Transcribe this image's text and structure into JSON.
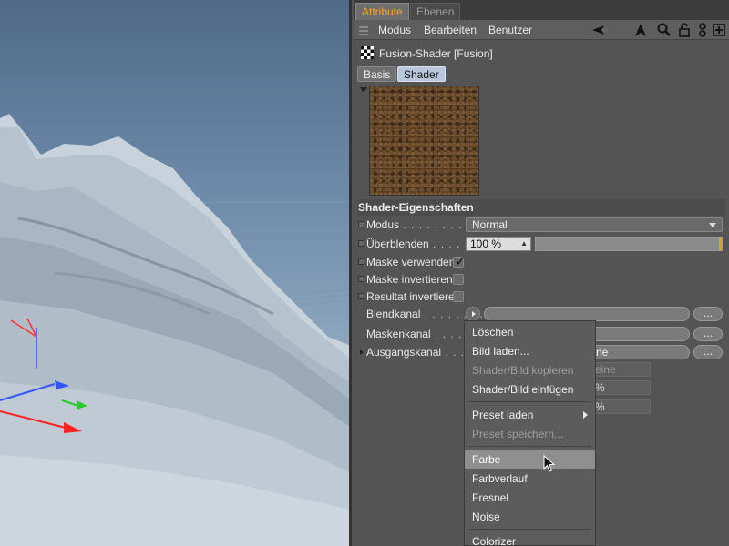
{
  "tabs": {
    "attribute": "Attribute",
    "ebenen": "Ebenen"
  },
  "menu": {
    "modus": "Modus",
    "bearbeiten": "Bearbeiten",
    "benutzer": "Benutzer"
  },
  "object": {
    "title": "Fusion-Shader [Fusion]"
  },
  "subtabs": {
    "basis": "Basis",
    "shader": "Shader"
  },
  "section": {
    "title": "Shader-Eigenschaften"
  },
  "rows": {
    "modus": {
      "label": "Modus",
      "dots": " . . . . . . . . . . . .",
      "value": "Normal"
    },
    "ueberblenden": {
      "label": "Überblenden",
      "dots": " . . . . . .",
      "value": "100 %",
      "level": 1.0
    },
    "maske_verwenden": {
      "label": "Maske verwenden",
      "checked": true
    },
    "maske_invertieren": {
      "label": "Maske invertieren"
    },
    "resultat_invertieren": {
      "label": "Resultat invertieren"
    },
    "blendkanal": {
      "label": "Blendkanal",
      "dots": " . . . . . . . . ."
    },
    "maskenkanal": {
      "label": "Maskenkanal",
      "dots": " . . . . . . . ."
    },
    "ausgangskanal": {
      "label": "Ausgangskanal",
      "dots": " . . . . .",
      "value": "ne"
    },
    "extra1": {
      "value": "eine"
    },
    "extra2": {
      "value": "%"
    },
    "extra3": {
      "value": "%"
    }
  },
  "buttons": {
    "dots": "..."
  },
  "context_menu": {
    "items": [
      {
        "label": "Löschen",
        "enabled": true
      },
      {
        "label": "Bild laden...",
        "enabled": true
      },
      {
        "label": "Shader/Bild kopieren",
        "enabled": false
      },
      {
        "label": "Shader/Bild einfügen",
        "enabled": true
      },
      {
        "label": "Preset laden",
        "enabled": true,
        "submenu": true
      },
      {
        "label": "Preset speichern...",
        "enabled": false
      },
      {
        "label": "Farbe",
        "enabled": true,
        "highlighted": true
      },
      {
        "label": "Farbverlauf",
        "enabled": true
      },
      {
        "label": "Fresnel",
        "enabled": true
      },
      {
        "label": "Noise",
        "enabled": true
      },
      {
        "label": "Colorizer",
        "enabled": true
      }
    ]
  },
  "colors": {
    "accent": "#f5a623",
    "active_subtab": "#b9c6dc",
    "highlight": "#8f8f8f"
  },
  "icons": [
    "arrow-left-icon",
    "cursor-icon",
    "search-icon",
    "lock-icon",
    "link-icon",
    "new-panel-icon"
  ]
}
